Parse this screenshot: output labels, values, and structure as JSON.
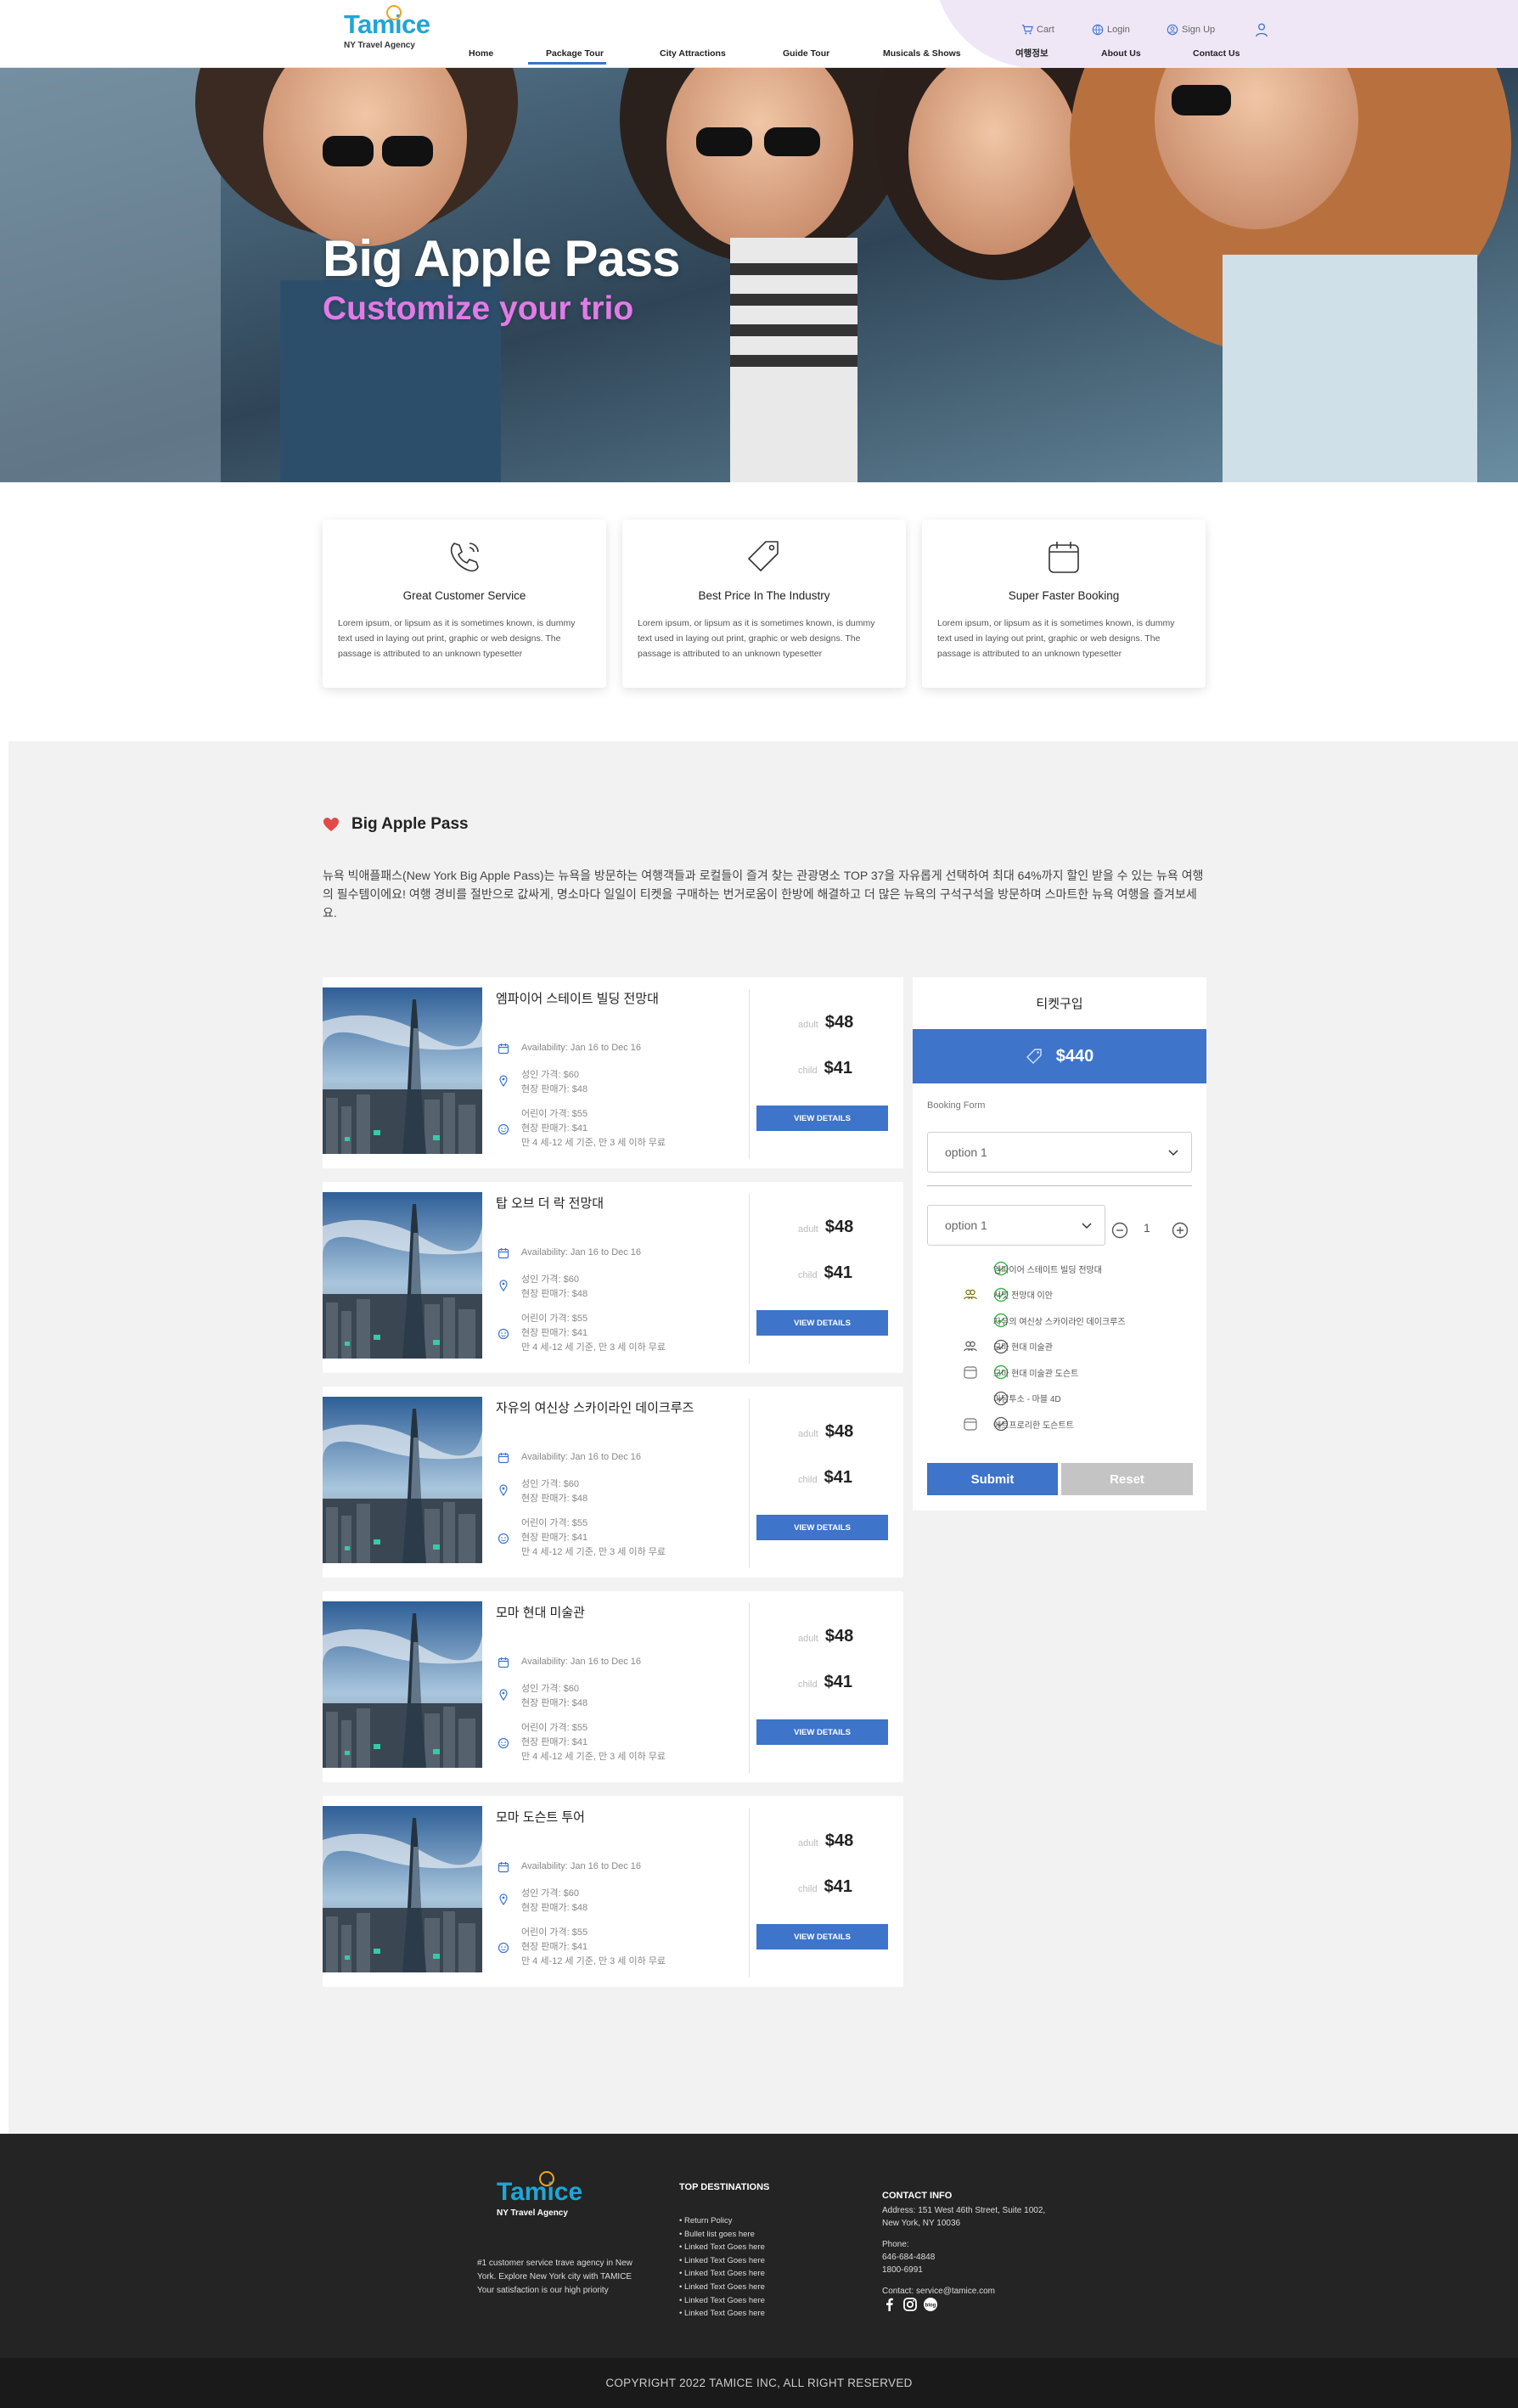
{
  "header": {
    "logo_text": "Tamice",
    "logo_sub": "NY Travel Agency",
    "util": {
      "cart": "Cart",
      "login": "Login",
      "signup": "Sign Up"
    },
    "nav": [
      "Home",
      "Package Tour",
      "City Attractions",
      "Guide Tour",
      "Musicals & Shows",
      "여행정보",
      "About Us",
      "Contact Us"
    ],
    "active_nav": "Package Tour"
  },
  "hero": {
    "title": "Big Apple Pass",
    "subtitle": "Customize your trio"
  },
  "features": [
    {
      "icon": "phone-icon",
      "title": "Great Customer Service",
      "text": "Lorem ipsum, or lipsum as it is sometimes known, is dummy text used in laying out print, graphic or web designs. The passage is attributed to an unknown typesetter"
    },
    {
      "icon": "price-tag-icon",
      "title": "Best Price In The Industry",
      "text": "Lorem ipsum, or lipsum as it is sometimes known, is dummy text used in laying out print, graphic or web designs. The passage is attributed to an unknown typesetter"
    },
    {
      "icon": "calendar-icon",
      "title": "Super Faster Booking",
      "text": "Lorem ipsum, or lipsum as it is sometimes known, is dummy text used in laying out print, graphic or web designs. The passage is attributed to an unknown typesetter"
    }
  ],
  "section": {
    "title": "Big Apple Pass",
    "intro": "뉴욕 빅애플패스(New York Big Apple Pass)는 뉴욕을 방문하는 여행객들과 로컬들이 즐겨 찾는 관광명소 TOP 37을 자유롭게 선택하여 최대 64%까지 할인 받을 수 있는 뉴욕 여행의 필수템이에요! 여행 경비를 절반으로 값싸게, 명소마다 일일이 티켓을 구매하는 번거로움이 한방에 해결하고 더 많은 뉴욕의 구석구석을 방문하며 스마트한 뉴욕 여행을 즐겨보세요."
  },
  "tours": [
    {
      "name": "엠파이어 스테이트 빌딩 전망대",
      "availability": "Availability: Jan 16 to Dec 16",
      "adult_line1": "성인 가격: $60",
      "adult_line2": "현장 판매가: $48",
      "child_line1": "어린이 가격: $55",
      "child_line2": "현장 판매가: $41",
      "child_line3": "만 4 세-12 세 기준, 만 3 세 이하 무료",
      "adult_label": "adult",
      "adult_price": "$48",
      "child_label": "child",
      "child_price": "$41",
      "button": "VIEW DETAILS"
    },
    {
      "name": "탑 오브 더 락 전망대",
      "availability": "Availability: Jan 16 to Dec 16",
      "adult_line1": "성인 가격: $60",
      "adult_line2": "현장 판매가: $48",
      "child_line1": "어린이 가격: $55",
      "child_line2": "현장 판매가: $41",
      "child_line3": "만 4 세-12 세 기준, 만 3 세 이하 무료",
      "adult_label": "adult",
      "adult_price": "$48",
      "child_label": "child",
      "child_price": "$41",
      "button": "VIEW DETAILS"
    },
    {
      "name": "자유의 여신상 스카이라인 데이크루즈",
      "availability": "Availability: Jan 16 to Dec 16",
      "adult_line1": "성인 가격: $60",
      "adult_line2": "현장 판매가: $48",
      "child_line1": "어린이 가격: $55",
      "child_line2": "현장 판매가: $41",
      "child_line3": "만 4 세-12 세 기준, 만 3 세 이하 무료",
      "adult_label": "adult",
      "adult_price": "$48",
      "child_label": "child",
      "child_price": "$41",
      "button": "VIEW DETAILS"
    },
    {
      "name": "모마 현대 미술관",
      "availability": "Availability: Jan 16 to Dec 16",
      "adult_line1": "성인 가격: $60",
      "adult_line2": "현장 판매가: $48",
      "child_line1": "어린이 가격: $55",
      "child_line2": "현장 판매가: $41",
      "child_line3": "만 4 세-12 세 기준, 만 3 세 이하 무료",
      "adult_label": "adult",
      "adult_price": "$48",
      "child_label": "child",
      "child_price": "$41",
      "button": "VIEW DETAILS"
    },
    {
      "name": "모마 도슨트 투어",
      "availability": "Availability: Jan 16 to Dec 16",
      "adult_line1": "성인 가격: $60",
      "adult_line2": "현장 판매가: $48",
      "child_line1": "어린이 가격: $55",
      "child_line2": "현장 판매가: $41",
      "child_line3": "만 4 세-12 세 기준, 만 3 세 이하 무료",
      "adult_label": "adult",
      "adult_price": "$48",
      "child_label": "child",
      "child_price": "$41",
      "button": "VIEW DETAILS"
    }
  ],
  "booking": {
    "title": "티켓구입",
    "total": "$440",
    "form_label": "Booking Form",
    "select1": "option 1",
    "select2": "option 1",
    "quantity": "1",
    "items": [
      {
        "label": "엠파이어 스테이트 빌딩 전망대",
        "checked": true,
        "mid_icon": "none"
      },
      {
        "label": "서밋 전망대 이안",
        "checked": true,
        "mid_icon": "group-icon"
      },
      {
        "label": "자유의 여신상 스카이라인 데이크루즈",
        "checked": true,
        "mid_icon": "none"
      },
      {
        "label": "모마 현대 미술관",
        "checked": false,
        "mid_icon": "group-icon"
      },
      {
        "label": "모마 현대 미술관 도슨트",
        "checked": true,
        "mid_icon": "calendar-icon"
      },
      {
        "label": "마담투소 - 마블 4D",
        "checked": false,
        "mid_icon": "none"
      },
      {
        "label": "에트프로리한 도슨트트",
        "checked": false,
        "mid_icon": "calendar-icon"
      }
    ],
    "submit": "Submit",
    "reset": "Reset"
  },
  "footer": {
    "logo_text": "Tamice",
    "logo_sub": "NY Travel Agency",
    "description": "#1 customer service trave agency in New York. Explore New York city with TAMICE Your satisfaction is our high priority",
    "dest_title": "TOP DESTINATIONS",
    "destinations": [
      "• Return Policy",
      "• Bullet list goes here",
      "• Linked Text Goes here",
      "• Linked Text Goes here",
      "• Linked Text Goes here",
      "• Linked Text Goes here",
      "• Linked Text Goes here",
      "• Linked Text Goes here"
    ],
    "contact_title": "CONTACT INFO",
    "address": "Address: 151 West 46th Street, Suite 1002, New York, NY 10036",
    "phone_label": "Phone:",
    "phone1": "646-684-4848",
    "phone2": "1800-6991",
    "email": "Contact: service@tamice.com",
    "copyright": "COPYRIGHT 2022 TAMICE INC, ALL RIGHT RESERVED"
  }
}
